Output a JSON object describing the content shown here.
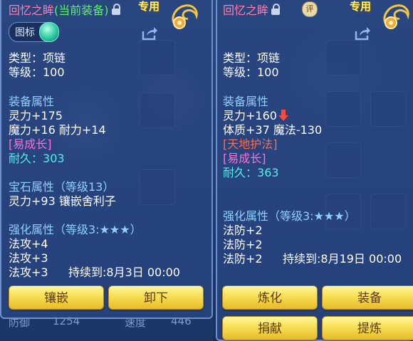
{
  "left": {
    "title_name": "回忆之眸",
    "title_tag": "(当前装备)",
    "exclusive": "专用",
    "label_button": "图标",
    "type": "类型：项链",
    "level": "等级：100",
    "equip_attr_title": "装备属性",
    "attr_line1": "灵力+175",
    "attr_line2": "魔力+16 耐力+14",
    "growth": "[易成长]",
    "durability_label": "耐久：",
    "durability_value": "303",
    "gem_line1": "宝石属性（等级13）",
    "gem_line2": "灵力+93 镶嵌舍利子",
    "enhance_title": "强化属性（等级3:★★★）",
    "enh1": "法攻+4",
    "enh2": "法攻+3",
    "enh3": "法攻+3",
    "enh_duration": "持续到:8月3日 00:00",
    "btn1": "镶嵌",
    "btn2": "卸下"
  },
  "right": {
    "title_name": "回忆之眸",
    "review_badge": "评",
    "exclusive": "专用",
    "type": "类型：项链",
    "level": "等级：100",
    "equip_attr_title": "装备属性",
    "attr_line1": "灵力+160",
    "attr_line2": "体质+37 魔法-130",
    "special": "[天地护法]",
    "growth": "[易成长]",
    "durability_label": "耐久：",
    "durability_value": "363",
    "enhance_title": "强化属性（等级3:★★★）",
    "enh1": "法防+2",
    "enh2": "法防+2",
    "enh3": "法防+2",
    "enh_duration": "持续到:8月19日 00:00",
    "btn1": "炼化",
    "btn2": "装备",
    "btn3": "捐献",
    "btn4": "提炼"
  },
  "strip": {
    "defense_label": "防御",
    "defense_value": "1254",
    "speed_label": "速度",
    "speed_value": "446"
  },
  "colors": {
    "accent_gold": "#f6de55",
    "title_pink": "#ff7fb0",
    "equipped_green": "#5df06a",
    "section_blue": "#8fd0ff",
    "growth_pink": "#ff6fd7",
    "special_red": "#ff6b4a",
    "durability_cyan": "#4ff0e8"
  },
  "icons": [
    "lock-icon",
    "share-icon",
    "gem-ornament-icon",
    "down-arrow-icon",
    "review-badge-icon"
  ]
}
